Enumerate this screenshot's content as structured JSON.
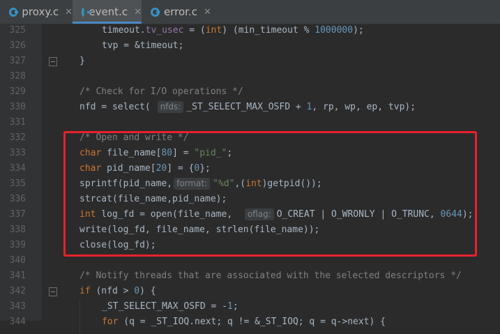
{
  "tabs": [
    {
      "label": "proxy.c",
      "active": false
    },
    {
      "label": "event.c",
      "active": true
    },
    {
      "label": "error.c",
      "active": false
    }
  ],
  "lines": [
    {
      "n": "325",
      "indent": 1,
      "tokens": [
        [
          "txt",
          "timeout."
        ],
        [
          "fld",
          "tv_usec"
        ],
        [
          "txt",
          " = ("
        ],
        [
          "kw",
          "int"
        ],
        [
          "txt",
          ") (min_timeout % "
        ],
        [
          "num",
          "1000000"
        ],
        [
          "txt",
          ");"
        ]
      ]
    },
    {
      "n": "326",
      "indent": 1,
      "tokens": [
        [
          "txt",
          "tvp = &timeout;"
        ]
      ]
    },
    {
      "n": "327",
      "indent": 0,
      "tokens": [
        [
          "txt",
          "}"
        ]
      ],
      "fold": true
    },
    {
      "n": "328",
      "indent": 0,
      "tokens": []
    },
    {
      "n": "329",
      "indent": 0,
      "tokens": [
        [
          "com",
          "/* Check for I/O operations */"
        ]
      ]
    },
    {
      "n": "330",
      "indent": 0,
      "tokens": [
        [
          "txt",
          "nfd = select( "
        ],
        [
          "hint",
          "nfds:"
        ],
        [
          "txt",
          "_ST_SELECT_MAX_OSFD + "
        ],
        [
          "num",
          "1"
        ],
        [
          "txt",
          ", rp, wp, ep, tvp);"
        ]
      ]
    },
    {
      "n": "331",
      "indent": 0,
      "tokens": []
    },
    {
      "n": "332",
      "indent": 0,
      "tokens": [
        [
          "com",
          "/* Open and write */"
        ]
      ]
    },
    {
      "n": "333",
      "indent": 0,
      "tokens": [
        [
          "kw",
          "char"
        ],
        [
          "txt",
          " file_name["
        ],
        [
          "num",
          "80"
        ],
        [
          "txt",
          "] = "
        ],
        [
          "str",
          "\"pid_\""
        ],
        [
          "txt",
          ";"
        ]
      ]
    },
    {
      "n": "334",
      "indent": 0,
      "tokens": [
        [
          "kw",
          "char"
        ],
        [
          "txt",
          " pid_name["
        ],
        [
          "num",
          "20"
        ],
        [
          "txt",
          "] = {"
        ],
        [
          "num",
          "0"
        ],
        [
          "txt",
          "};"
        ]
      ]
    },
    {
      "n": "335",
      "indent": 0,
      "tokens": [
        [
          "txt",
          "sprintf(pid_name,"
        ],
        [
          "hint",
          "format:"
        ],
        [
          "str",
          "\"%d\""
        ],
        [
          "txt",
          ",("
        ],
        [
          "kw",
          "int"
        ],
        [
          "txt",
          ")getpid());"
        ]
      ]
    },
    {
      "n": "336",
      "indent": 0,
      "tokens": [
        [
          "txt",
          "strcat(file_name,pid_name);"
        ]
      ]
    },
    {
      "n": "337",
      "indent": 0,
      "tokens": [
        [
          "kw",
          "int"
        ],
        [
          "txt",
          " log_fd = open(file_name,  "
        ],
        [
          "hint",
          "oflag:"
        ],
        [
          "txt",
          "O_CREAT | O_WRONLY | O_TRUNC, "
        ],
        [
          "num",
          "0644"
        ],
        [
          "txt",
          ");"
        ]
      ]
    },
    {
      "n": "338",
      "indent": 0,
      "tokens": [
        [
          "txt",
          "write(log_fd, file_name, strlen(file_name));"
        ]
      ]
    },
    {
      "n": "339",
      "indent": 0,
      "tokens": [
        [
          "txt",
          "close(log_fd);"
        ]
      ]
    },
    {
      "n": "340",
      "indent": 0,
      "tokens": []
    },
    {
      "n": "341",
      "indent": 0,
      "tokens": [
        [
          "com",
          "/* Notify threads that are associated with the selected descriptors */"
        ]
      ]
    },
    {
      "n": "342",
      "indent": 0,
      "tokens": [
        [
          "kw",
          "if"
        ],
        [
          "txt",
          " (nfd > "
        ],
        [
          "num",
          "0"
        ],
        [
          "txt",
          ") {"
        ]
      ],
      "fold": true
    },
    {
      "n": "343",
      "indent": 1,
      "tokens": [
        [
          "txt",
          "_ST_SELECT_MAX_OSFD = -"
        ],
        [
          "num",
          "1"
        ],
        [
          "txt",
          ";"
        ]
      ]
    },
    {
      "n": "344",
      "indent": 1,
      "tokens": [
        [
          "kw",
          "for"
        ],
        [
          "txt",
          " (q = _ST_IOQ.next; q != &_ST_IOQ; q = q->next) {"
        ]
      ]
    }
  ]
}
